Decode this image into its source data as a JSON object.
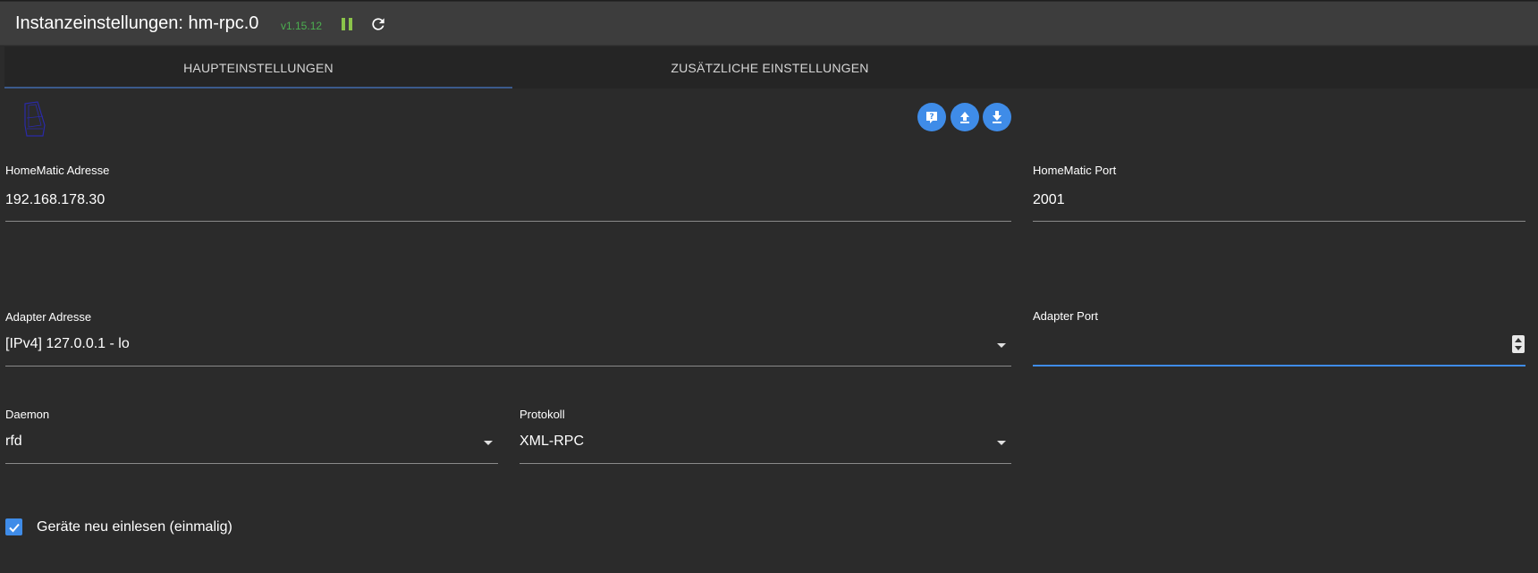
{
  "header": {
    "title": "Instanzeinstellungen: hm-rpc.0",
    "version": "v1.15.12",
    "pause_icon": "pause-icon",
    "reload_icon": "reload-icon",
    "version_color": "#4caf50"
  },
  "tabs": [
    {
      "label": "HAUPTEINSTELLUNGEN",
      "active": true
    },
    {
      "label": "ZUSÄTZLICHE EINSTELLUNGEN",
      "active": false
    }
  ],
  "toolbar": {
    "help_icon": "help-icon",
    "upload_icon": "upload-icon",
    "download_icon": "download-icon",
    "accent": "#3f8ce8"
  },
  "form": {
    "homematic_address": {
      "label": "HomeMatic Adresse",
      "value": "192.168.178.30"
    },
    "homematic_port": {
      "label": "HomeMatic Port",
      "value": "2001"
    },
    "adapter_address": {
      "label": "Adapter Adresse",
      "value": "[IPv4] 127.0.0.1 - lo"
    },
    "adapter_port": {
      "label": "Adapter Port",
      "value": ""
    },
    "daemon": {
      "label": "Daemon",
      "value": "rfd"
    },
    "protocol": {
      "label": "Protokoll",
      "value": "XML-RPC"
    },
    "reread_devices": {
      "label": "Geräte neu einlesen (einmalig)",
      "checked": true
    }
  }
}
